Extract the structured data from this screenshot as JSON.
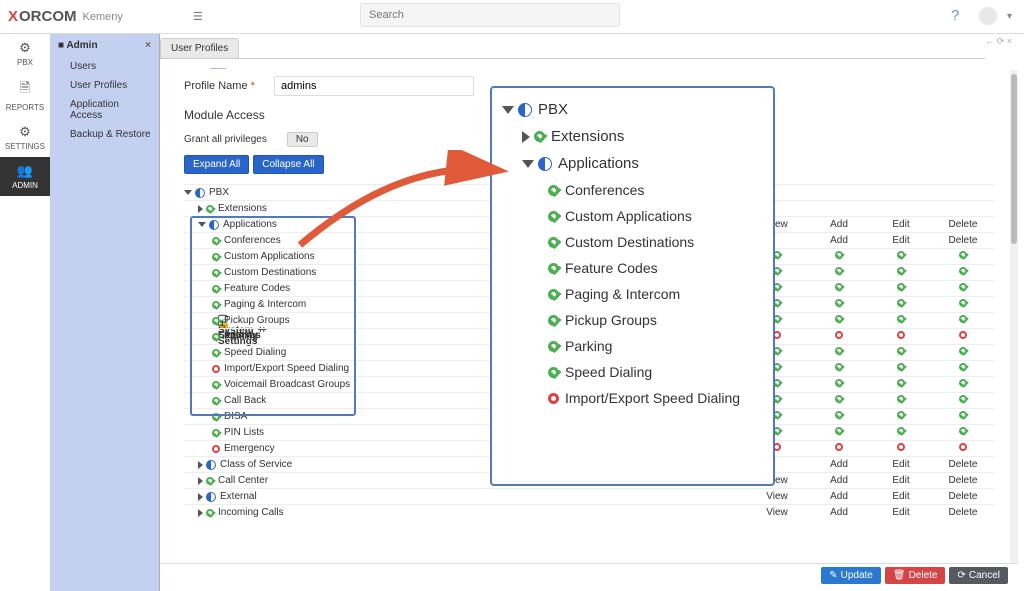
{
  "brand": {
    "name": "ORCOM",
    "prefix": "X",
    "sub": "Kemeny"
  },
  "search": {
    "placeholder": "Search"
  },
  "rail": [
    {
      "icon": "cog",
      "label": "PBX"
    },
    {
      "icon": "doc",
      "label": "REPORTS"
    },
    {
      "icon": "cogs",
      "label": "SETTINGS"
    },
    {
      "icon": "users",
      "label": "ADMIN"
    }
  ],
  "nav2": {
    "title": "Admin",
    "items": [
      "Users",
      "User Profiles",
      "Application Access",
      "Backup & Restore"
    ],
    "sections": [
      {
        "icon": "monitor",
        "label": "System Settings"
      },
      {
        "icon": "lock",
        "label": "Security"
      },
      {
        "icon": "key",
        "label": "Licenses"
      }
    ]
  },
  "tab": "User Profiles",
  "form": {
    "profile_name_label": "Profile Name",
    "profile_name_value": "admins",
    "module_access": "Module Access",
    "grant_all": "Grant all privileges",
    "no": "No",
    "expand": "Expand All",
    "collapse": "Collapse All"
  },
  "perm_headers": [
    "View",
    "Add",
    "Edit",
    "Delete"
  ],
  "tree": {
    "root": "PBX",
    "extensions": "Extensions",
    "applications": "Applications",
    "app_items": [
      {
        "label": "Conferences",
        "state": "ok"
      },
      {
        "label": "Custom Applications",
        "state": "ok"
      },
      {
        "label": "Custom Destinations",
        "state": "ok"
      },
      {
        "label": "Feature Codes",
        "state": "ok"
      },
      {
        "label": "Paging & Intercom",
        "state": "ok"
      },
      {
        "label": "Pickup Groups",
        "state": "ok"
      },
      {
        "label": "Parking",
        "state": "ok"
      },
      {
        "label": "Speed Dialing",
        "state": "ok"
      },
      {
        "label": "Import/Export Speed Dialing",
        "state": "no"
      }
    ],
    "more": [
      {
        "label": "Voicemail Broadcast Groups",
        "icon": "green",
        "perms": [
          "ok",
          "ok",
          "ok",
          "ok"
        ]
      },
      {
        "label": "Call Back",
        "icon": "green",
        "perms": [
          "ok",
          "ok",
          "ok",
          "ok"
        ]
      },
      {
        "label": "DISA",
        "icon": "green",
        "perms": [
          "ok",
          "ok",
          "ok",
          "ok"
        ]
      },
      {
        "label": "PIN Lists",
        "icon": "green",
        "perms": [
          "ok",
          "ok",
          "ok",
          "ok"
        ]
      },
      {
        "label": "Emergency",
        "icon": "red",
        "perms": [
          "no",
          "no",
          "no",
          "no"
        ]
      }
    ],
    "top_sections": [
      {
        "label": "Class of Service",
        "icon": "half",
        "heads": [
          "Add",
          "Edit",
          "Delete"
        ]
      },
      {
        "label": "Call Center",
        "icon": "green",
        "heads": [
          "View",
          "Add",
          "Edit",
          "Delete"
        ]
      },
      {
        "label": "External",
        "icon": "half",
        "heads": [
          "View",
          "Add",
          "Edit",
          "Delete"
        ]
      },
      {
        "label": "Incoming Calls",
        "icon": "green",
        "heads": [
          "View",
          "Add",
          "Edit",
          "Delete"
        ]
      }
    ],
    "app_row_perms": {
      "Conferences": [
        "ok",
        "ok",
        "ok",
        "ok"
      ],
      "Custom Applications": [
        "ok",
        "ok",
        "ok",
        "ok"
      ],
      "Custom Destinations": [
        "ok",
        "ok",
        "ok",
        "ok"
      ],
      "Feature Codes": [
        "ok",
        "ok",
        "ok",
        "ok"
      ],
      "Paging & Intercom": [
        "ok",
        "ok",
        "ok",
        "ok"
      ],
      "Pickup Groups": [
        "ok",
        "ok",
        "ok",
        "ok"
      ],
      "Parking": [
        "no",
        "no",
        "no",
        "no"
      ],
      "Speed Dialing": [
        "ok",
        "ok",
        "ok",
        "ok"
      ],
      "Import/Export Speed Dialing": [
        "ok",
        "ok",
        "ok",
        "ok"
      ]
    }
  },
  "zoom": {
    "root": "PBX",
    "extensions": "Extensions",
    "applications": "Applications"
  },
  "footer": {
    "update": "Update",
    "delete": "Delete",
    "cancel": "Cancel"
  }
}
